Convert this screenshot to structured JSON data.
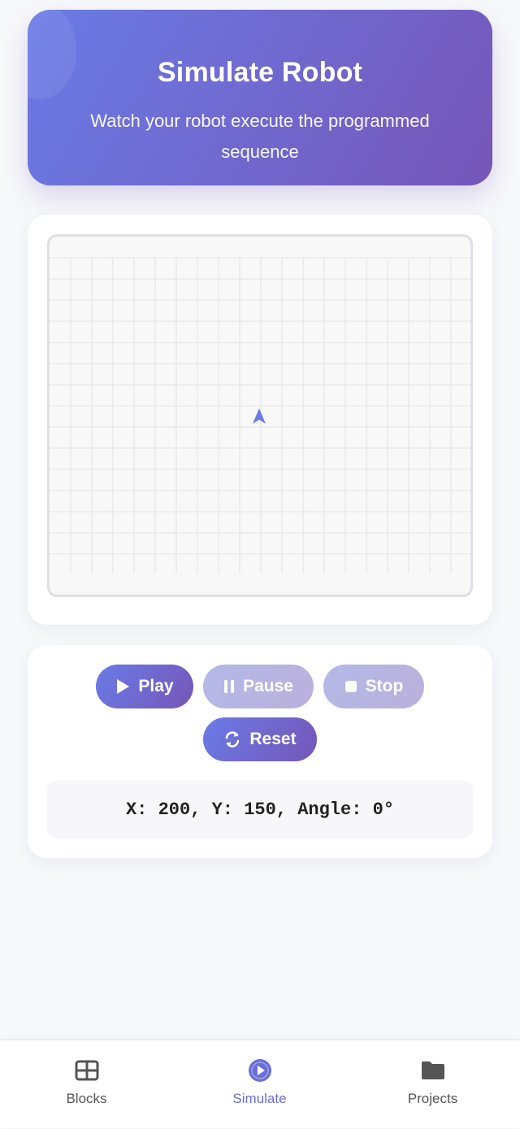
{
  "header": {
    "title": "Simulate Robot",
    "subtitle": "Watch your robot execute the programmed sequence"
  },
  "controls": {
    "play_label": "Play",
    "pause_label": "Pause",
    "stop_label": "Stop",
    "reset_label": "Reset",
    "pause_enabled": false,
    "stop_enabled": false
  },
  "status": {
    "text": "X: 200, Y: 150, Angle: 0°"
  },
  "nav": {
    "items": [
      {
        "label": "Blocks",
        "icon": "grid-icon",
        "active": false
      },
      {
        "label": "Simulate",
        "icon": "play-circle-icon",
        "active": true
      },
      {
        "label": "Projects",
        "icon": "folder-icon",
        "active": false
      }
    ]
  },
  "colors": {
    "accent": "#6a6fd8",
    "gradient_start": "#6a7be6",
    "gradient_end": "#7656b8",
    "robot": "#6a7be6",
    "grid_line": "#e2e2e2"
  }
}
